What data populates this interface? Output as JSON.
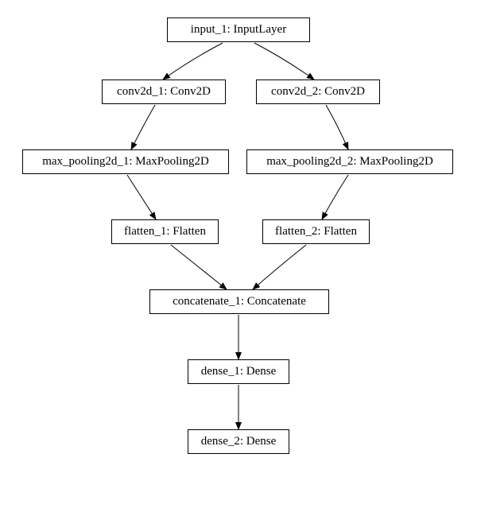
{
  "nodes": {
    "input_1": {
      "label": "input_1: InputLayer"
    },
    "conv2d_1": {
      "label": "conv2d_1: Conv2D"
    },
    "conv2d_2": {
      "label": "conv2d_2: Conv2D"
    },
    "max_pooling2d_1": {
      "label": "max_pooling2d_1: MaxPooling2D"
    },
    "max_pooling2d_2": {
      "label": "max_pooling2d_2: MaxPooling2D"
    },
    "flatten_1": {
      "label": "flatten_1: Flatten"
    },
    "flatten_2": {
      "label": "flatten_2: Flatten"
    },
    "concatenate_1": {
      "label": "concatenate_1: Concatenate"
    },
    "dense_1": {
      "label": "dense_1: Dense"
    },
    "dense_2": {
      "label": "dense_2: Dense"
    }
  },
  "edges": [
    {
      "from": "input_1",
      "to": "conv2d_1"
    },
    {
      "from": "input_1",
      "to": "conv2d_2"
    },
    {
      "from": "conv2d_1",
      "to": "max_pooling2d_1"
    },
    {
      "from": "conv2d_2",
      "to": "max_pooling2d_2"
    },
    {
      "from": "max_pooling2d_1",
      "to": "flatten_1"
    },
    {
      "from": "max_pooling2d_2",
      "to": "flatten_2"
    },
    {
      "from": "flatten_1",
      "to": "concatenate_1"
    },
    {
      "from": "flatten_2",
      "to": "concatenate_1"
    },
    {
      "from": "concatenate_1",
      "to": "dense_1"
    },
    {
      "from": "dense_1",
      "to": "dense_2"
    }
  ]
}
